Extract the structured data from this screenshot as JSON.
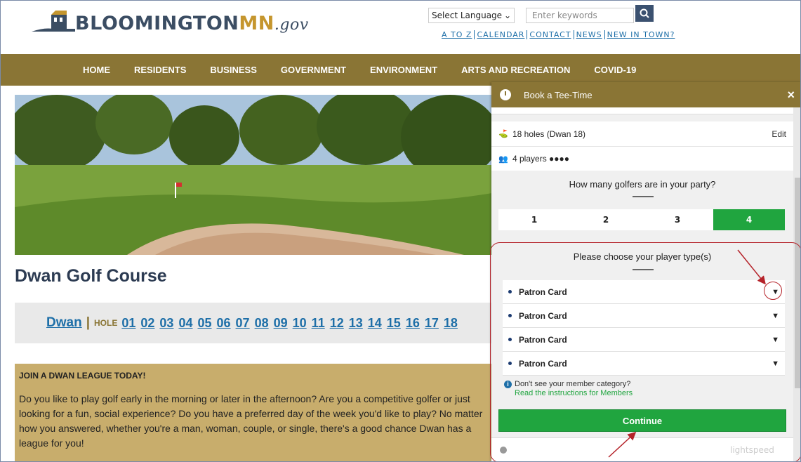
{
  "header": {
    "logo_main": "BLOOMINGTON",
    "logo_mn": "MN",
    "logo_gov": ".gov",
    "language": "Select Language",
    "search_placeholder": "Enter keywords",
    "links": [
      "A TO Z",
      "CALENDAR",
      "CONTACT",
      "NEWS",
      "NEW IN TOWN?"
    ]
  },
  "nav": [
    "HOME",
    "RESIDENTS",
    "BUSINESS",
    "GOVERNMENT",
    "ENVIRONMENT",
    "ARTS AND RECREATION",
    "COVID-19"
  ],
  "page": {
    "title": "Dwan Golf Course",
    "dwan_link": "Dwan",
    "hole_label": "HOLE",
    "holes": [
      "01",
      "02",
      "03",
      "04",
      "05",
      "06",
      "07",
      "08",
      "09",
      "10",
      "11",
      "12",
      "13",
      "14",
      "15",
      "16",
      "17",
      "18"
    ],
    "league_heading": "JOIN A DWAN LEAGUE TODAY!",
    "league_text": "Do you like to play golf early in the morning or later in the afternoon? Are you a competitive golfer or just looking for a fun, social experience? Do you have a preferred day of the week you'd like to play? No matter how you answered, whether you're a man, woman, couple, or single, there's a good chance Dwan has a league for you!"
  },
  "modal": {
    "title": "Book a Tee-Time",
    "close": "×",
    "holes_row": "18 holes (Dwan 18)",
    "edit": "Edit",
    "players_row": "4 players ●●●●",
    "question": "How many golfers are in your party?",
    "counts": [
      "1",
      "2",
      "3",
      "4"
    ],
    "selected_count": "4",
    "player_type_q": "Please choose your player type(s)",
    "player_types": [
      "Patron Card",
      "Patron Card",
      "Patron Card",
      "Patron Card"
    ],
    "info_text": "Don't see your member category?",
    "info_link": "Read the instructions for Members",
    "continue": "Continue",
    "powered": "lightspeed"
  },
  "colors": {
    "nav": "#8a7535",
    "accent_green": "#20a53f",
    "annotation_red": "#b5232a"
  }
}
